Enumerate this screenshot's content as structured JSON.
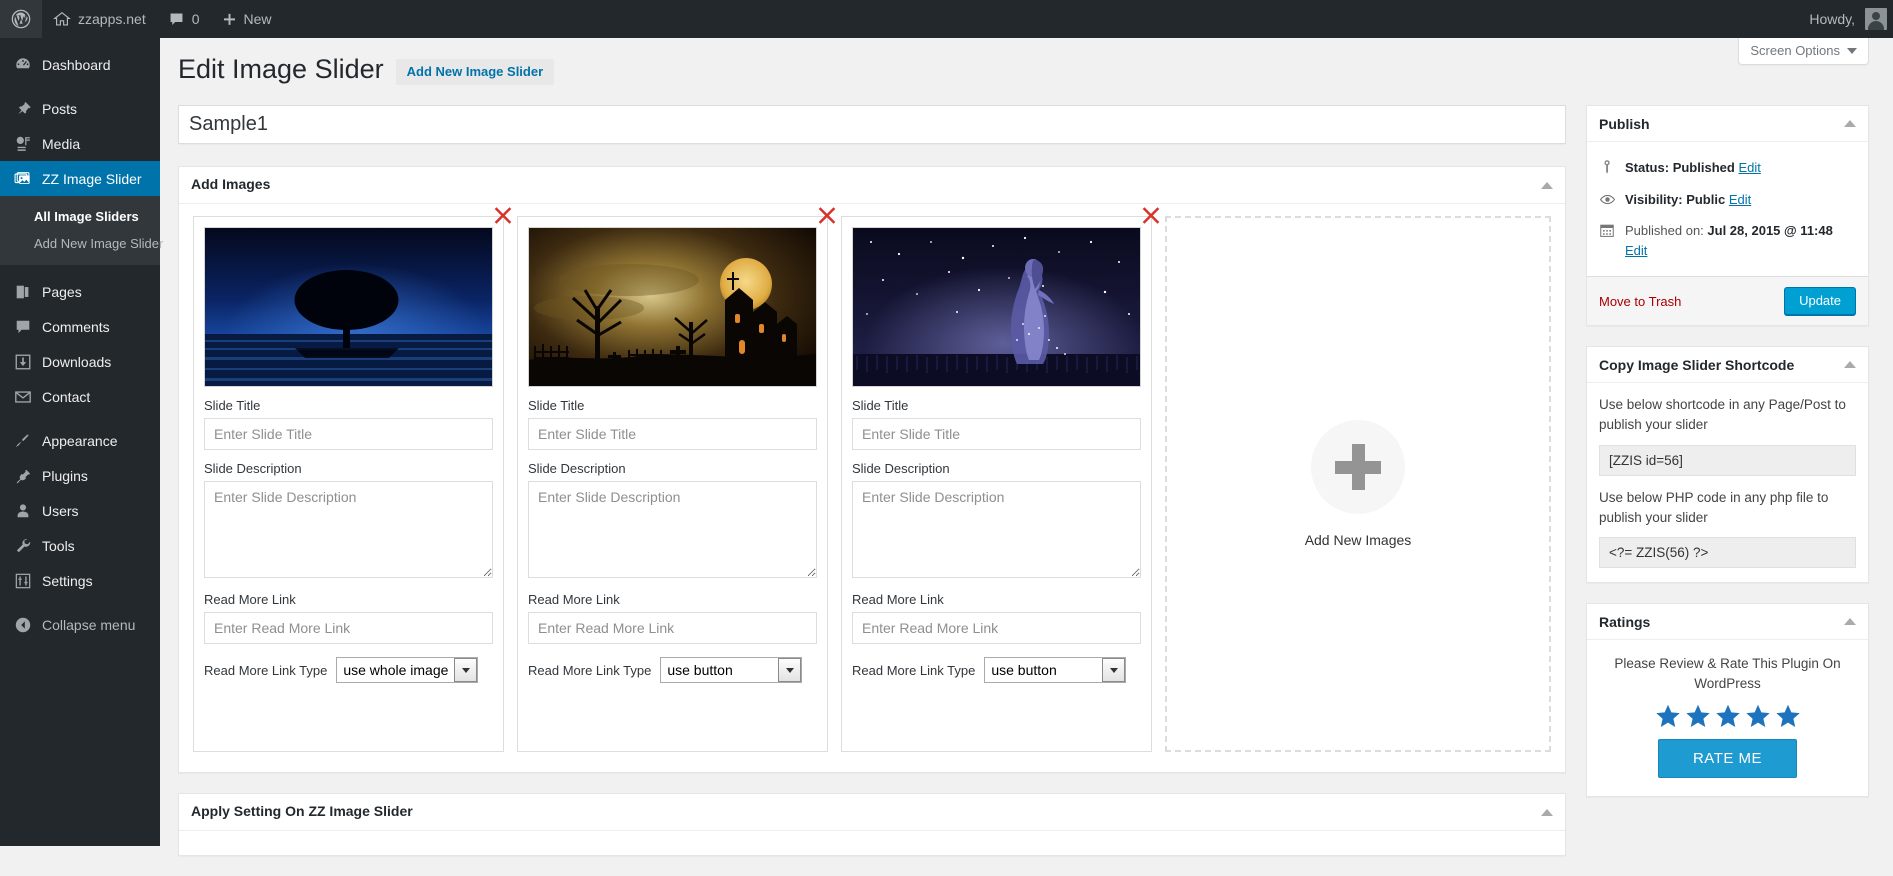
{
  "adminbar": {
    "wp_logo": "wordpress-logo-icon",
    "site_name": "zzapps.net",
    "comment_count": "0",
    "new_label": "New",
    "howdy": "Howdy,"
  },
  "sidebar": {
    "items": [
      {
        "label": "Dashboard",
        "icon": "dashboard-icon",
        "current": false
      },
      {
        "label": "Posts",
        "icon": "pin-icon",
        "current": false
      },
      {
        "label": "Media",
        "icon": "media-icon",
        "current": false
      },
      {
        "label": "ZZ Image Slider",
        "icon": "images-icon",
        "current": true
      },
      {
        "label": "Pages",
        "icon": "pages-icon",
        "current": false
      },
      {
        "label": "Comments",
        "icon": "comment-icon",
        "current": false
      },
      {
        "label": "Downloads",
        "icon": "download-icon",
        "current": false
      },
      {
        "label": "Contact",
        "icon": "envelope-icon",
        "current": false
      },
      {
        "label": "Appearance",
        "icon": "brush-icon",
        "current": false
      },
      {
        "label": "Plugins",
        "icon": "plug-icon",
        "current": false
      },
      {
        "label": "Users",
        "icon": "user-icon",
        "current": false
      },
      {
        "label": "Tools",
        "icon": "wrench-icon",
        "current": false
      },
      {
        "label": "Settings",
        "icon": "settings-icon",
        "current": false
      },
      {
        "label": "Collapse menu",
        "icon": "collapse-icon",
        "current": false
      }
    ],
    "submenu": [
      {
        "label": "All Image Sliders",
        "active": true
      },
      {
        "label": "Add New Image Slider",
        "active": false
      }
    ]
  },
  "screen_options": {
    "label": "Screen Options"
  },
  "page": {
    "title": "Edit Image Slider",
    "add_new_label": "Add New Image Slider",
    "slider_title_value": "Sample1"
  },
  "add_images_box": {
    "title": "Add Images",
    "slides": [
      {
        "thumb": "night-tree-blue-water",
        "remove_label": "remove-slide",
        "title_label": "Slide Title",
        "title_value": "",
        "title_placeholder": "Enter Slide Title",
        "desc_label": "Slide Description",
        "desc_value": "",
        "desc_placeholder": "Enter Slide Description",
        "link_label": "Read More Link",
        "link_value": "",
        "link_placeholder": "Enter Read More Link",
        "linktype_label": "Read More Link Type",
        "linktype_value": "use whole image",
        "linktype_options": [
          "use whole image",
          "use button"
        ]
      },
      {
        "thumb": "halloween-castle-moon",
        "remove_label": "remove-slide",
        "title_label": "Slide Title",
        "title_value": "",
        "title_placeholder": "Enter Slide Title",
        "desc_label": "Slide Description",
        "desc_value": "",
        "desc_placeholder": "Enter Slide Description",
        "link_label": "Read More Link",
        "link_value": "",
        "link_placeholder": "Enter Read More Link",
        "linktype_label": "Read More Link Type",
        "linktype_value": "use button",
        "linktype_options": [
          "use whole image",
          "use button"
        ]
      },
      {
        "thumb": "starry-night-woman",
        "remove_label": "remove-slide",
        "title_label": "Slide Title",
        "title_value": "",
        "title_placeholder": "Enter Slide Title",
        "desc_label": "Slide Description",
        "desc_value": "",
        "desc_placeholder": "Enter Slide Description",
        "link_label": "Read More Link",
        "link_value": "",
        "link_placeholder": "Enter Read More Link",
        "linktype_label": "Read More Link Type",
        "linktype_value": "use button",
        "linktype_options": [
          "use whole image",
          "use button"
        ]
      }
    ],
    "dropzone_label": "Add New Images"
  },
  "apply_setting_box": {
    "title": "Apply Setting On ZZ Image Slider"
  },
  "publish": {
    "title": "Publish",
    "status_label": "Status:",
    "status_value": "Published",
    "status_edit": "Edit",
    "visibility_label": "Visibility:",
    "visibility_value": "Public",
    "visibility_edit": "Edit",
    "published_label": "Published on:",
    "published_value": "Jul 28, 2015 @ 11:48",
    "published_edit": "Edit",
    "trash_label": "Move to Trash",
    "update_label": "Update"
  },
  "shortcode": {
    "title": "Copy Image Slider Shortcode",
    "desc1": "Use below shortcode in any Page/Post to publish your slider",
    "shortcode_value": "[ZZIS id=56]",
    "desc2": "Use below PHP code in any php file to publish your slider",
    "php_value": "<?= ZZIS(56) ?>"
  },
  "ratings": {
    "title": "Ratings",
    "text": "Please Review & Rate This Plugin On WordPress",
    "star_count": 5,
    "star_color": "#1e73be",
    "button_label": "RATE ME"
  },
  "colors": {
    "admin_bar": "#23282d",
    "sidebar": "#23282d",
    "current_menu": "#0073aa",
    "accent": "#00a0d2",
    "link": "#0073aa",
    "trash": "#a00",
    "remove_x": "#d9322a"
  }
}
